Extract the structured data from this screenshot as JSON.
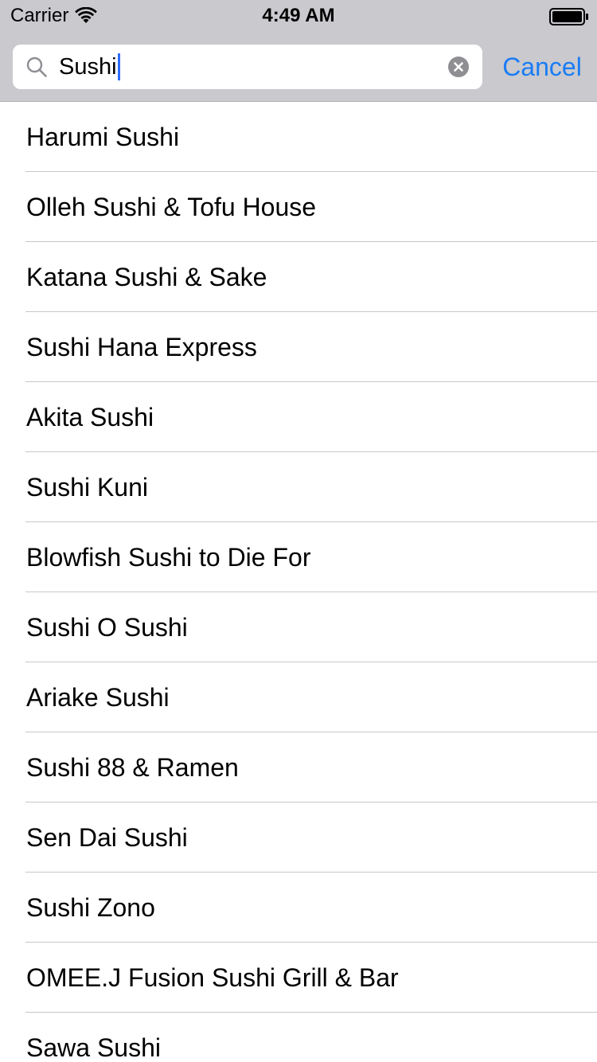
{
  "status_bar": {
    "carrier": "Carrier",
    "time": "4:49 AM"
  },
  "search": {
    "value": "Sushi",
    "cancel_label": "Cancel",
    "accent_color": "#1a7cf5"
  },
  "results": [
    "Harumi Sushi",
    "Olleh Sushi & Tofu House",
    "Katana Sushi & Sake",
    "Sushi Hana Express",
    "Akita Sushi",
    "Sushi Kuni",
    "Blowfish Sushi to Die For",
    "Sushi O Sushi",
    "Ariake Sushi",
    "Sushi 88 & Ramen",
    "Sen Dai Sushi",
    "Sushi Zono",
    "OMEE.J Fusion Sushi Grill & Bar",
    "Sawa Sushi"
  ]
}
